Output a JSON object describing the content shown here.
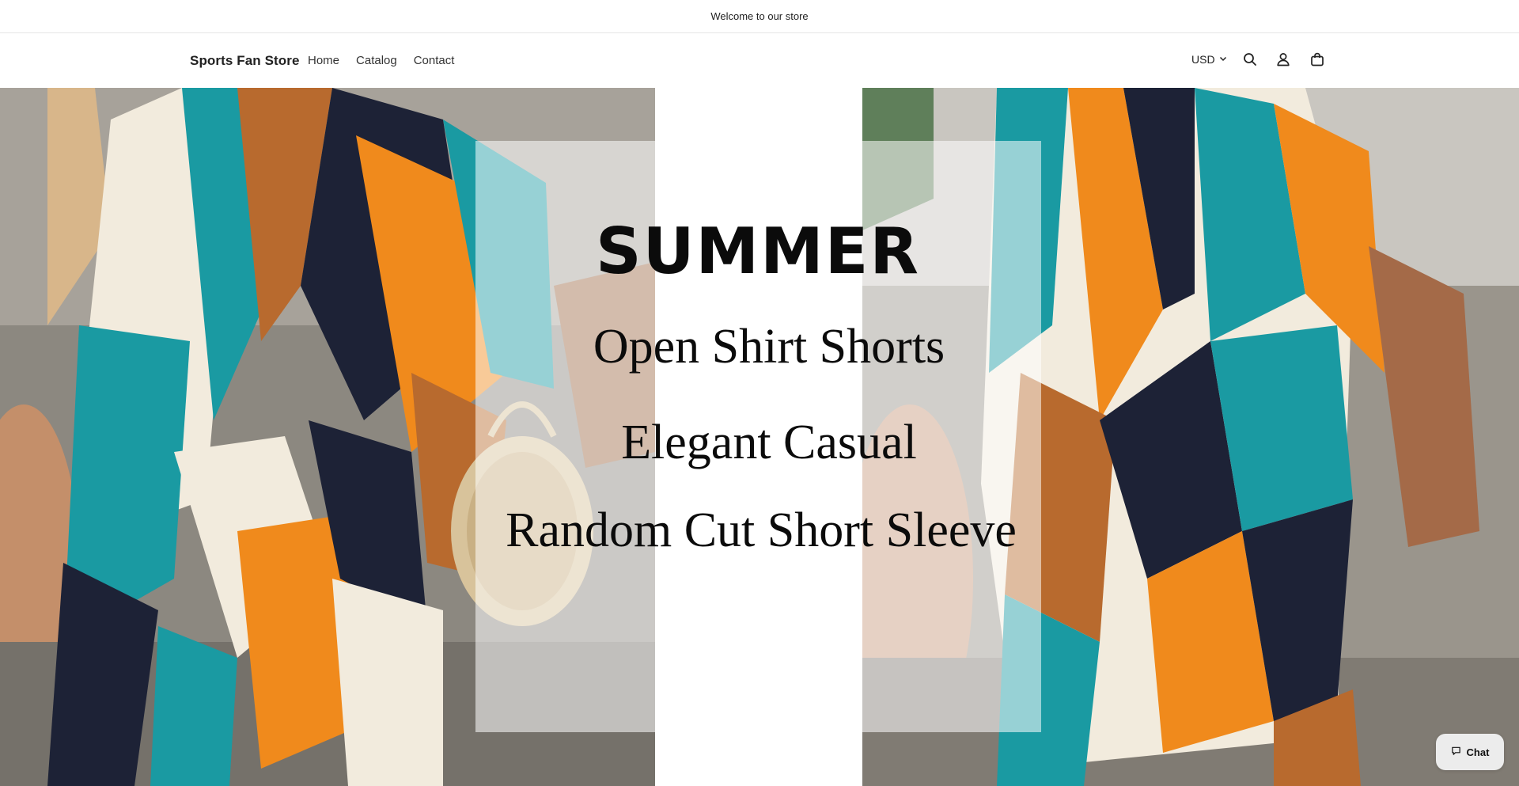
{
  "announcement": {
    "text": "Welcome to our store"
  },
  "header": {
    "brand": "Sports Fan Store",
    "nav": [
      {
        "label": "Home"
      },
      {
        "label": "Catalog"
      },
      {
        "label": "Contact"
      }
    ],
    "currency": "USD",
    "icons": [
      "search-icon",
      "account-icon",
      "cart-icon",
      "chevron-down-icon"
    ]
  },
  "hero": {
    "line1": "SUMMER",
    "line2": "Open Shirt Shorts",
    "line3": "Elegant Casual",
    "line4": "Random Cut Short Sleeve"
  },
  "chat": {
    "label": "Chat",
    "icon": "chat-bubble-icon"
  },
  "colors": {
    "teal": "#1a9aa2",
    "orange": "#f08a1c",
    "navy": "#1d2236",
    "cream": "#f3ece0",
    "rust": "#b86a2e"
  }
}
